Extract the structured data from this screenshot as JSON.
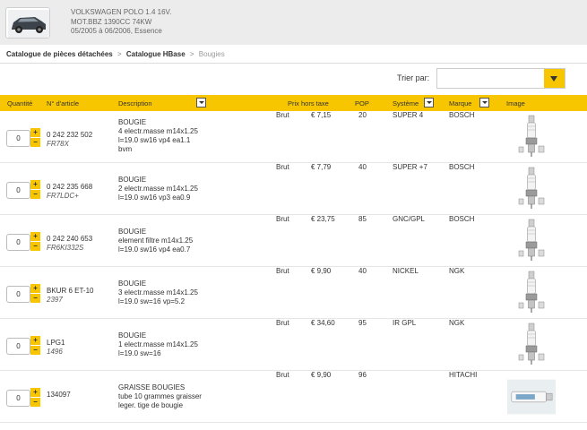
{
  "vehicle": {
    "model": "VOLKSWAGEN POLO 1.4 16V.",
    "engine": "MOT.BBZ 1390CC 74KW",
    "period": "05/2005 à 06/2006, Essence"
  },
  "breadcrumb": {
    "items": [
      "Catalogue de pièces détachées",
      "Catalogue HBase"
    ],
    "current": "Bougies",
    "separator": ">"
  },
  "sort": {
    "label": "Trier par:",
    "value": ""
  },
  "table": {
    "headers": {
      "quantity": "Quantité",
      "article": "N° d'article",
      "description": "Description",
      "price": "Prix hors taxe",
      "pop": "POP",
      "system": "Système",
      "brand": "Marque",
      "image": "Image"
    },
    "rows": [
      {
        "qty": "0",
        "article": "0 242 232 502",
        "ref": "FR78X",
        "desc": [
          "BOUGIE",
          "4 electr.masse m14x1.25",
          "l=19.0 sw16 vp4 ea1.1",
          "bvm"
        ],
        "type": "Brut",
        "price": "€ 7,15",
        "pop": "20",
        "system": "SUPER 4",
        "brand": "BOSCH",
        "image": "spark-plug-image"
      },
      {
        "qty": "0",
        "article": "0 242 235 668",
        "ref": "FR7LDC+",
        "desc": [
          "BOUGIE",
          "2 electr.masse m14x1.25",
          "l=19.0 sw16 vp3 ea0.9"
        ],
        "type": "Brut",
        "price": "€ 7,79",
        "pop": "40",
        "system": "SUPER +7",
        "brand": "BOSCH",
        "image": "spark-plug-image"
      },
      {
        "qty": "0",
        "article": "0 242 240 653",
        "ref": "FR6KI332S",
        "desc": [
          "BOUGIE",
          "element filtre m14x1.25",
          "l=19.0 sw16 vp4 ea0.7"
        ],
        "type": "Brut",
        "price": "€ 23,75",
        "pop": "85",
        "system": "GNC/GPL",
        "brand": "BOSCH",
        "image": "spark-plug-image"
      },
      {
        "qty": "0",
        "article": "BKUR 6 ET-10",
        "ref": "2397",
        "desc": [
          "BOUGIE",
          "3 electr.masse m14x1.25",
          "l=19.0 sw=16 vp=5.2"
        ],
        "type": "Brut",
        "price": "€ 9,90",
        "pop": "40",
        "system": "NICKEL",
        "brand": "NGK",
        "image": "spark-plug-image"
      },
      {
        "qty": "0",
        "article": "LPG1",
        "ref": "1496",
        "desc": [
          "BOUGIE",
          "1 electr.masse m14x1.25",
          "l=19.0 sw=16"
        ],
        "type": "Brut",
        "price": "€ 34,60",
        "pop": "95",
        "system": "IR GPL",
        "brand": "NGK",
        "image": "spark-plug-image"
      },
      {
        "qty": "0",
        "article": "134097",
        "ref": "",
        "desc": [
          "GRAISSE BOUGIES",
          "tube 10 grammes graisser",
          "leger. tige de bougie"
        ],
        "type": "Brut",
        "price": "€ 9,90",
        "pop": "96",
        "system": "",
        "brand": "HITACHI",
        "image": "grease-tube-image"
      }
    ]
  },
  "colors": {
    "accent": "#f7c600",
    "header_bg": "#ececec"
  }
}
